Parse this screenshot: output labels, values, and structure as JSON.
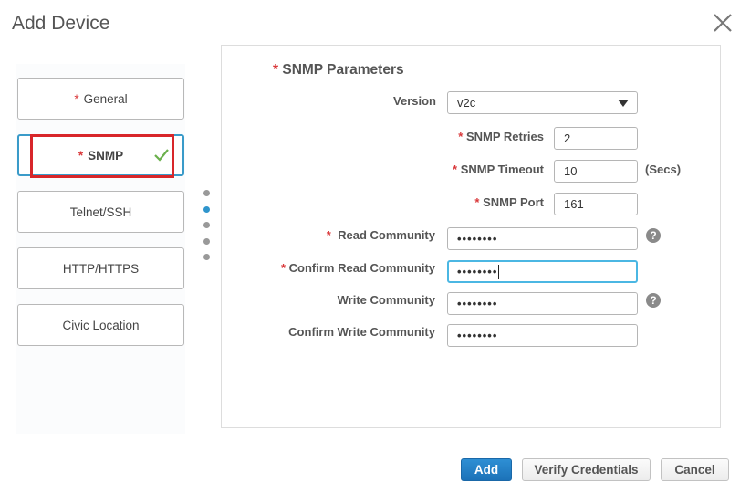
{
  "dialog": {
    "title": "Add Device",
    "close_icon": "close-x-icon"
  },
  "sidebar": {
    "items": [
      {
        "label": "General",
        "required": true,
        "required_mark": "*"
      },
      {
        "label": "SNMP",
        "required": true,
        "required_mark": "*",
        "active": true,
        "completed_icon": "checkmark-icon"
      },
      {
        "label": "Telnet/SSH",
        "required": false
      },
      {
        "label": "HTTP/HTTPS",
        "required": false
      },
      {
        "label": "Civic Location",
        "required": false
      }
    ],
    "step_indicator": {
      "total": 5,
      "active_index": 1
    }
  },
  "form": {
    "section_title": "SNMP Parameters",
    "required_mark": "*",
    "version": {
      "label": "Version",
      "value": "v2c"
    },
    "retries": {
      "label": "SNMP Retries",
      "value": "2"
    },
    "timeout": {
      "label": "SNMP Timeout",
      "value": "10",
      "unit": "(Secs)"
    },
    "port": {
      "label": "SNMP Port",
      "value": "161"
    },
    "read_community": {
      "label": "Read Community",
      "value": "••••••••",
      "help": "?"
    },
    "confirm_read_community": {
      "label": "Confirm Read Community",
      "value": "••••••••"
    },
    "write_community": {
      "label": "Write Community",
      "value": "••••••••",
      "help": "?"
    },
    "confirm_write_community": {
      "label": "Confirm Write Community",
      "value": "••••••••"
    }
  },
  "footer": {
    "add_label": "Add",
    "verify_label": "Verify Credentials",
    "cancel_label": "Cancel"
  },
  "colors": {
    "primary": "#1f78c1",
    "required": "#d9383a",
    "active_border": "#3a9bc9",
    "highlight": "#d8262a",
    "check": "#6ab04c"
  }
}
